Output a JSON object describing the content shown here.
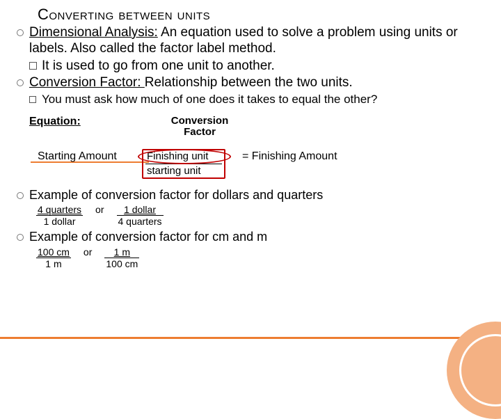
{
  "title": "Converting between units",
  "dim_label": "Dimensional Analysis:",
  "dim_def": " An equation used to solve a problem using units or labels. Also called the factor label method.",
  "dim_sub": "It is used to go from one unit to another.",
  "conv_label": "Conversion Factor: ",
  "conv_def": "Relationship between the two units.",
  "conv_sub": "You must ask how much of one does it takes to equal the other?",
  "eq_label": "Equation:",
  "conv_header": "Conversion Factor",
  "start": "Starting Amount",
  "cf_num": "Finishing unit",
  "cf_den": "starting unit",
  "finish": "= Finishing Amount",
  "ex1": "Example of conversion factor for dollars and quarters",
  "ex1_a_num": "4 quarters",
  "ex1_a_den": "1 dollar",
  "or": "or",
  "ex1_b_num": "1 dollar",
  "ex1_b_den": "4 quarters",
  "ex2": "Example of conversion factor for cm and m",
  "ex2_a_num": "100 cm",
  "ex2_a_den": "1 m",
  "ex2_b_num": "1 m",
  "ex2_b_den": "100 cm"
}
